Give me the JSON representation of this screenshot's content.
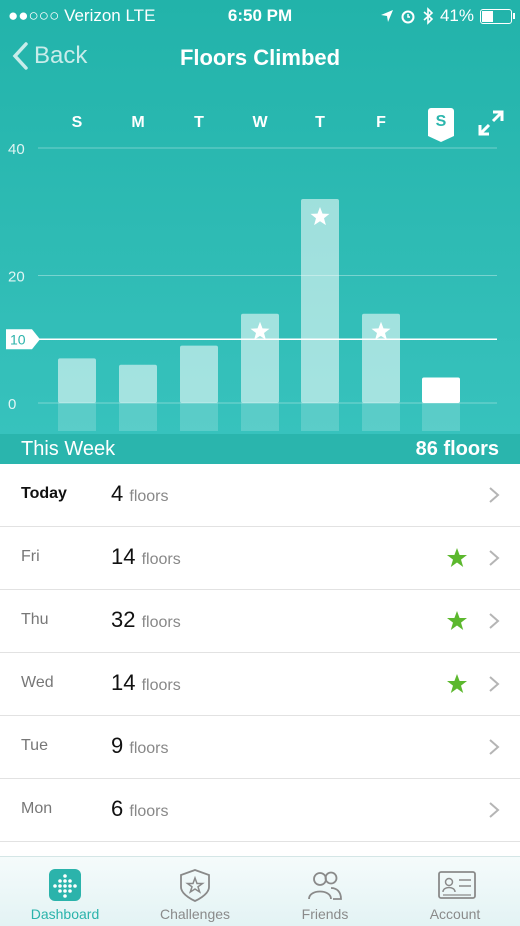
{
  "status_bar": {
    "carrier": "●●○○○ Verizon  LTE",
    "time": "6:50 PM",
    "battery": "41%",
    "battery_level": 0.41
  },
  "nav": {
    "back_label": "Back",
    "title": "Floors Climbed"
  },
  "days": [
    "S",
    "M",
    "T",
    "W",
    "T",
    "F",
    "S"
  ],
  "selected_day_index": 6,
  "chart_data": {
    "type": "bar",
    "categories": [
      "S",
      "M",
      "T",
      "W",
      "T",
      "F",
      "S"
    ],
    "values": [
      7,
      6,
      9,
      14,
      32,
      14,
      4
    ],
    "goal_met": [
      false,
      false,
      false,
      true,
      true,
      true,
      false
    ],
    "goal_line": 10,
    "goal_label": "10",
    "ylim": [
      0,
      40
    ],
    "ytick_labels": [
      "40",
      "20",
      "0"
    ],
    "yticks": [
      40,
      20,
      0
    ],
    "grid": true,
    "bar_color": "#ffffff"
  },
  "summary": {
    "label": "This Week",
    "total": "86 floors"
  },
  "rows": [
    {
      "day": "Today",
      "value": "4",
      "unit": "floors",
      "star": false
    },
    {
      "day": "Fri",
      "value": "14",
      "unit": "floors",
      "star": true
    },
    {
      "day": "Thu",
      "value": "32",
      "unit": "floors",
      "star": true
    },
    {
      "day": "Wed",
      "value": "14",
      "unit": "floors",
      "star": true
    },
    {
      "day": "Tue",
      "value": "9",
      "unit": "floors",
      "star": false
    },
    {
      "day": "Mon",
      "value": "6",
      "unit": "floors",
      "star": false
    }
  ],
  "tabs": [
    {
      "label": "Dashboard",
      "icon": "dashboard-icon",
      "active": true
    },
    {
      "label": "Challenges",
      "icon": "challenges-icon",
      "active": false
    },
    {
      "label": "Friends",
      "icon": "friends-icon",
      "active": false
    },
    {
      "label": "Account",
      "icon": "account-icon",
      "active": false
    }
  ],
  "colors": {
    "accent": "#2bb3ab",
    "star": "#5cb82e"
  }
}
